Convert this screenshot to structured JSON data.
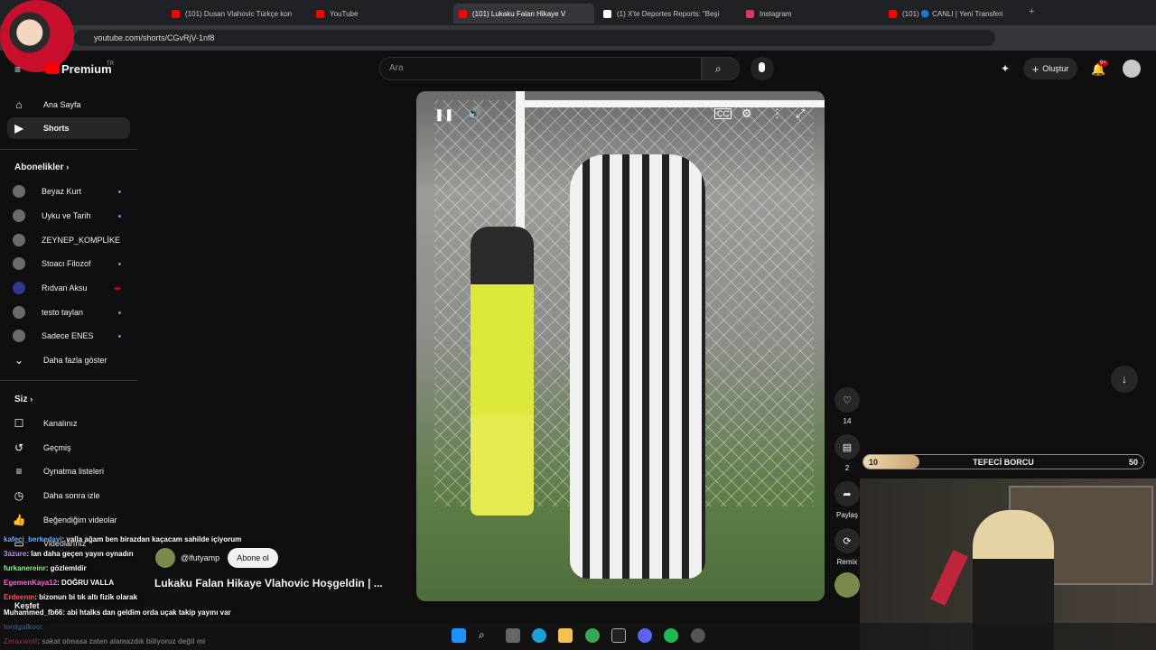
{
  "browser": {
    "tabs": [
      {
        "title": "(101) Dusan Vlahovic Türkçe kon",
        "color": "#ff0000"
      },
      {
        "title": "YouTube",
        "color": "#ff0000"
      },
      {
        "title": "(101) Lukaku Falan Hikaye V",
        "color": "#ff0000"
      },
      {
        "title": "(1) X'te Deportes Reports: \"Beşi",
        "color": "#ffffff"
      },
      {
        "title": "Instagram",
        "color": "#e1306c"
      },
      {
        "title": "(101) 🔵 CANLI | Yeni Transferi",
        "color": "#ff0000"
      }
    ],
    "url": "youtube.com/shorts/CGvRjV-1nf8"
  },
  "header": {
    "logo_text": "Premium",
    "logo_sup": "TR",
    "search_placeholder": "Ara",
    "create_label": "Oluştur",
    "notif_count": "9+"
  },
  "sidebar": {
    "main": [
      {
        "label": "Ana Sayfa",
        "icon": "home-icon"
      },
      {
        "label": "Shorts",
        "icon": "shorts-icon"
      }
    ],
    "subs_title": "Abonelikler",
    "subscriptions": [
      {
        "label": "Beyaz Kurt"
      },
      {
        "label": "Uyku ve Tarih"
      },
      {
        "label": "ZEYNEP_KOMPLİKE"
      },
      {
        "label": "Stoacı Filozof"
      },
      {
        "label": "Rıdvan Aksu"
      },
      {
        "label": "testo taylan"
      },
      {
        "label": "Sadece ENES"
      },
      {
        "label": "Daha fazla göster"
      }
    ],
    "you_title": "Siz",
    "you_items": [
      {
        "label": "Kanalınız"
      },
      {
        "label": "Geçmiş"
      },
      {
        "label": "Oynatma listeleri"
      },
      {
        "label": "Daha sonra izle"
      },
      {
        "label": "Beğendiğim videolar"
      },
      {
        "label": "Videolarınız"
      }
    ],
    "explore_title": "Keşfet"
  },
  "short": {
    "title": "Lukaku Falan Hikaye Vlahovic Hoşgeldin | ...",
    "channel": "@lfutyamp",
    "subscribe_label": "Abone ol",
    "likes": "14",
    "comments": "2",
    "share_label": "Paylaş",
    "remix_label": "Remix"
  },
  "chat": [
    {
      "user": "kafeci_berkedayi",
      "text": ": valla ağam ben birazdan kaçacam sahilde içiyorum",
      "color": "#6ab0ff"
    },
    {
      "user": "3azure",
      "text": ": lan daha geçen yayın oynadın",
      "color": "#c68cff"
    },
    {
      "user": "furkanereinr",
      "text": ": gözlemldir",
      "color": "#7cff7c"
    },
    {
      "user": "EgemenKaya12",
      "text": ": DOĞRU VALLA",
      "color": "#ff6bd5"
    },
    {
      "user": "Erdeenm",
      "text": ": bizonun bi tık altı fizik olarak",
      "color": "#ff5a5a"
    },
    {
      "user": "Muhammed_fb66",
      "text": ": abi htalks dan geldim orda uçak takip yayını var",
      "color": "#ffffff"
    },
    {
      "user": "lordgalkoo",
      "text": ":",
      "color": "#6ab0ff"
    },
    {
      "user": "Zeraxwolf",
      "text": ": sakat olmasa zaten alamazdık biliyoruz değil mi",
      "color": "#ff5a5a"
    }
  ],
  "overlay": {
    "goal_label": "TEFECİ BORCU",
    "goal_current": "10",
    "goal_target": "50",
    "goal_fraction": 0.2
  }
}
